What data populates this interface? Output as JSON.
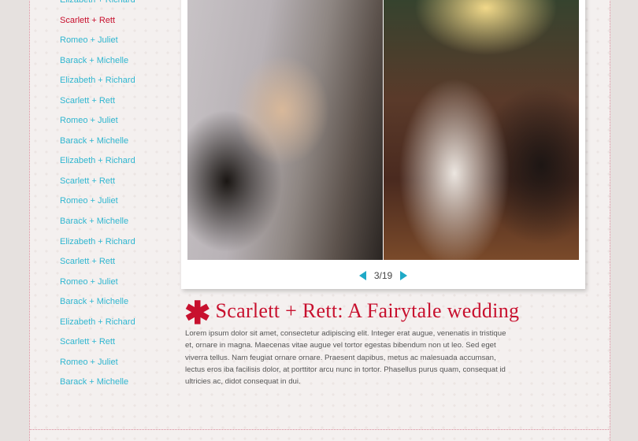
{
  "sidebar": {
    "items": [
      {
        "label": "Elizabeth + Richard",
        "active": false
      },
      {
        "label": "Scarlett + Rett",
        "active": true
      },
      {
        "label": "Romeo + Juliet",
        "active": false
      },
      {
        "label": "Barack + Michelle",
        "active": false
      },
      {
        "label": "Elizabeth + Richard",
        "active": false
      },
      {
        "label": "Scarlett + Rett",
        "active": false
      },
      {
        "label": "Romeo + Juliet",
        "active": false
      },
      {
        "label": "Barack + Michelle",
        "active": false
      },
      {
        "label": "Elizabeth + Richard",
        "active": false
      },
      {
        "label": "Scarlett + Rett",
        "active": false
      },
      {
        "label": "Romeo + Juliet",
        "active": false
      },
      {
        "label": "Barack + Michelle",
        "active": false
      },
      {
        "label": "Elizabeth + Richard",
        "active": false
      },
      {
        "label": "Scarlett + Rett",
        "active": false
      },
      {
        "label": "Romeo + Juliet",
        "active": false
      },
      {
        "label": "Barack + Michelle",
        "active": false
      },
      {
        "label": "Elizabeth + Richard",
        "active": false
      },
      {
        "label": "Scarlett + Rett",
        "active": false
      },
      {
        "label": "Romeo + Juliet",
        "active": false
      },
      {
        "label": "Barack + Michelle",
        "active": false
      }
    ],
    "link_color": "#2fb6d0",
    "active_color": "#c8102e"
  },
  "gallery": {
    "counter": "3/19",
    "prev_icon": "triangle-left-icon",
    "next_icon": "triangle-right-icon",
    "arrow_color": "#1fa9c7"
  },
  "article": {
    "asterisk": "✱",
    "title": "Scarlett + Rett: A Fairytale wedding",
    "body": "Lorem ipsum dolor sit amet, consectetur adipiscing elit. Integer erat augue, venenatis in tristique et, ornare in magna. Maecenas vitae augue vel tortor egestas bibendum non ut leo. Sed eget viverra tellus. Nam feugiat ornare ornare. Praesent dapibus, metus ac malesuada accumsan, lectus eros iba facilisis dolor, at porttitor arcu nunc in tortor. Phasellus purus quam, consequat id ultricies ac, didot consequat in dui.",
    "accent_color": "#c8102e"
  }
}
